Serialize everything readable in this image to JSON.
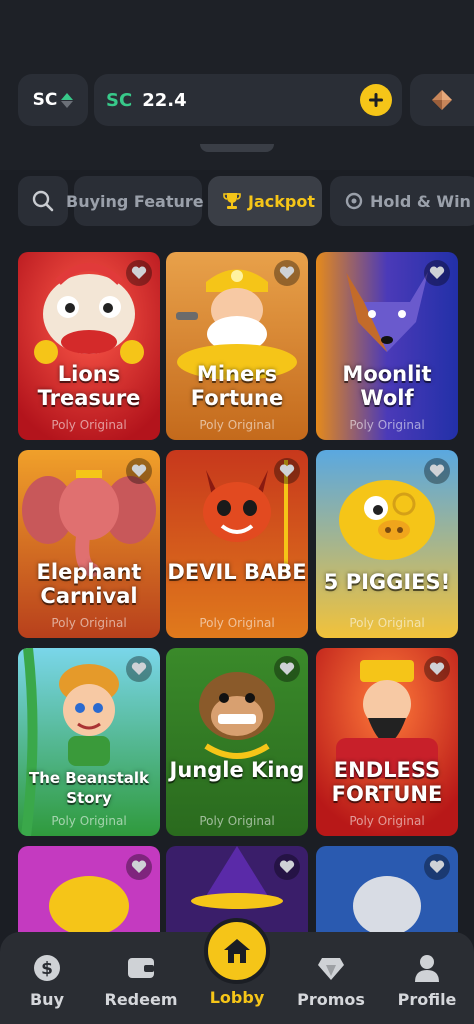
{
  "header": {
    "currency_toggle": "SC",
    "balance_currency": "SC",
    "balance_amount": "22.4"
  },
  "filters": {
    "chips": [
      {
        "label": "Buying Feature",
        "active": false
      },
      {
        "label": "Jackpot",
        "active": true
      },
      {
        "label": "Hold & Win",
        "active": false
      }
    ]
  },
  "games": [
    {
      "title": "Lions Treasure",
      "subtitle": "Poly Original"
    },
    {
      "title": "Miners Fortune",
      "subtitle": "Poly Original"
    },
    {
      "title": "Moonlit Wolf",
      "subtitle": "Poly Original"
    },
    {
      "title": "Elephant Carnival",
      "subtitle": "Poly Original"
    },
    {
      "title": "DEVIL BABE",
      "subtitle": "Poly Original"
    },
    {
      "title": "5 PIGGIES!",
      "subtitle": "Poly Original"
    },
    {
      "title": "The Beanstalk Story",
      "subtitle": "Poly Original"
    },
    {
      "title": "Jungle King",
      "subtitle": "Poly Original"
    },
    {
      "title": "ENDLESS FORTUNE",
      "subtitle": "Poly Original"
    }
  ],
  "nav": {
    "items": [
      {
        "label": "Buy",
        "icon": "dollar-coin-icon"
      },
      {
        "label": "Redeem",
        "icon": "wallet-icon"
      },
      {
        "label": "Lobby",
        "icon": "home-icon"
      },
      {
        "label": "Promos",
        "icon": "diamond-icon"
      },
      {
        "label": "Profile",
        "icon": "user-icon"
      }
    ]
  },
  "colors": {
    "accent": "#f5c518",
    "sc_green": "#38c98a",
    "background": "#1b1e24"
  }
}
